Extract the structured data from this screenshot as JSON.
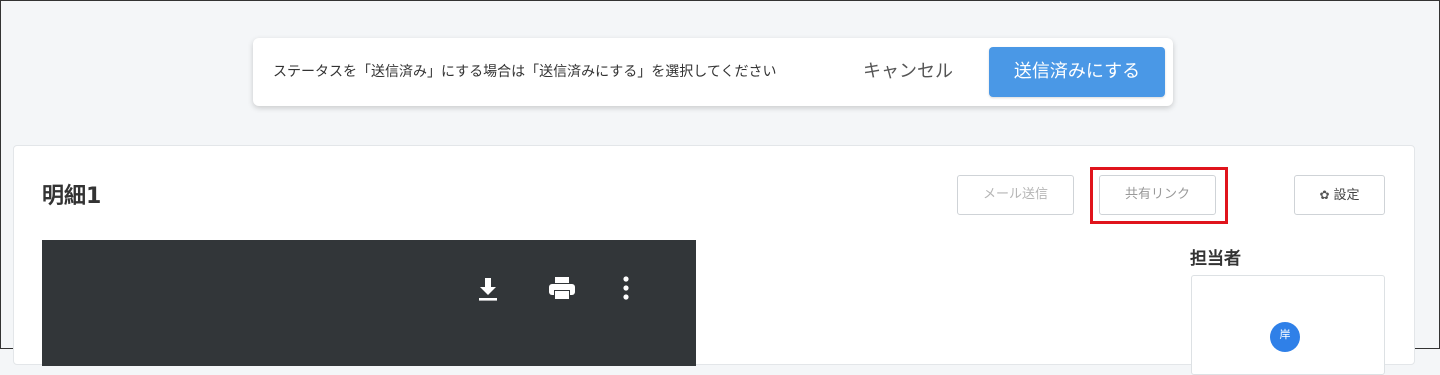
{
  "notice": {
    "message": "ステータスを「送信済み」にする場合は「送信済みにする」を選択してください",
    "cancel_label": "キャンセル",
    "confirm_label": "送信済みにする"
  },
  "card": {
    "title": "明細1",
    "mail_button_label": "メール送信",
    "share_link_button_label": "共有リンク",
    "settings_button_label": "設定",
    "settings_icon": "gear-icon",
    "assignee_label": "担当者",
    "avatar_initial": "岸"
  },
  "viewer": {
    "toolbar_icons": [
      "download-icon",
      "print-icon",
      "more-vertical-icon"
    ]
  },
  "colors": {
    "primary": "#4a98e6",
    "highlight": "#e0141c",
    "viewer_bg": "#323639",
    "avatar": "#2f80e8"
  }
}
